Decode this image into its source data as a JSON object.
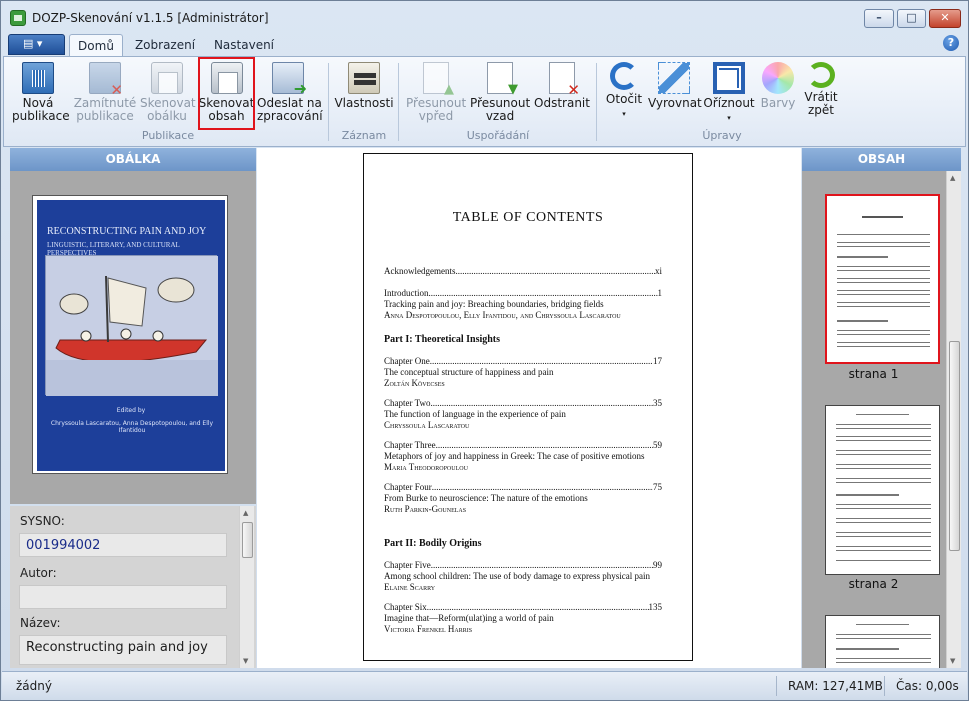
{
  "window": {
    "title": "DOZP-Skenování v1.1.5 [Administrátor]",
    "min_symbol": "–",
    "max_symbol": "□",
    "close_symbol": "✕"
  },
  "ribbon_tabs": [
    {
      "label": "Domů",
      "active": true
    },
    {
      "label": "Zobrazení",
      "active": false
    },
    {
      "label": "Nastavení",
      "active": false
    }
  ],
  "help_symbol": "?",
  "app_menu_symbol": "▤ ▾",
  "ribbon": {
    "publikace": {
      "group_label": "Publikace",
      "nova": {
        "label": "Nová\npublikace",
        "icon": "book-icon",
        "enabled": true
      },
      "zamitnute": {
        "label": "Zamítnuté\npublikace",
        "icon": "rejected-book-icon",
        "enabled": false
      },
      "skenovat_obalku": {
        "label": "Skenovat\nobálku",
        "icon": "scanner-icon",
        "enabled": false
      },
      "skenovat_obsah": {
        "label": "Skenovat\nobsah",
        "icon": "scanner-icon",
        "enabled": true,
        "highlighted": true
      },
      "odeslat": {
        "label": "Odeslat na\nzpracování",
        "icon": "send-icon",
        "enabled": true
      }
    },
    "zaznam": {
      "group_label": "Záznam",
      "vlastnosti": {
        "label": "Vlastnosti",
        "icon": "hand-card-icon",
        "enabled": true
      }
    },
    "usporadani": {
      "group_label": "Uspořádání",
      "presunout_vpred": {
        "label": "Přesunout\nvpřed",
        "icon": "page-up-icon",
        "enabled": false
      },
      "presunout_vzad": {
        "label": "Přesunout\nvzad",
        "icon": "page-down-icon",
        "enabled": true
      },
      "odstranit": {
        "label": "Odstranit",
        "icon": "page-delete-icon",
        "enabled": true
      }
    },
    "upravy": {
      "group_label": "Úpravy",
      "otocit": {
        "label": "Otočit",
        "icon": "rotate-icon",
        "enabled": true,
        "dropdown": "▾"
      },
      "vyrovnat": {
        "label": "Vyrovnat",
        "icon": "straighten-icon",
        "enabled": true
      },
      "oriznout": {
        "label": "Oříznout",
        "icon": "crop-icon",
        "enabled": true,
        "dropdown": "▾"
      },
      "barvy": {
        "label": "Barvy",
        "icon": "color-wheel-icon",
        "enabled": false
      },
      "vratit": {
        "label": "Vrátit\nzpět",
        "icon": "undo-icon",
        "enabled": true
      }
    }
  },
  "left_panel": {
    "header": "OBÁLKA",
    "cover": {
      "title": "RECONSTRUCTING PAIN AND JOY",
      "subtitle": "LINGUISTIC, LITERARY, AND CULTURAL PERSPECTIVES",
      "edited_by": "Edited by",
      "editors": "Chryssoula Lascaratou, Anna Despotopoulou, and Elly Ifantidou"
    },
    "fields": {
      "sysno_label": "SYSNO:",
      "sysno_value": "001994002",
      "autor_label": "Autor:",
      "autor_value": "",
      "nazev_label": "Název:",
      "nazev_value": "Reconstructing pain and joy"
    }
  },
  "page_preview": {
    "title": "TABLE OF CONTENTS",
    "entries": [
      {
        "name": "Acknowledgements",
        "page": "xi",
        "title": "",
        "author": ""
      },
      {
        "name": "Introduction",
        "page": "1",
        "title": "Tracking pain and joy: Breaching boundaries, bridging fields",
        "author": "Anna Despotopoulou, Elly Ifantidou, and Chryssoula Lascaratou"
      },
      {
        "name": "Chapter One",
        "page": "17",
        "title": "The conceptual structure of happiness and pain",
        "author": "Zoltán Kövecses"
      },
      {
        "name": "Chapter Two",
        "page": "35",
        "title": "The function of language in the experience of pain",
        "author": "Chryssoula Lascaratou"
      },
      {
        "name": "Chapter Three",
        "page": "59",
        "title": "Metaphors of joy and happiness in Greek: The case of positive emotions",
        "author": "Maria Theodoropoulou"
      },
      {
        "name": "Chapter Four",
        "page": "75",
        "title": "From Burke to neuroscience: The nature of the emotions",
        "author": "Ruth Parkin-Gounelas"
      },
      {
        "name": "Chapter Five",
        "page": "99",
        "title": "Among school children: The use of body damage to express physical pain",
        "author": "Elaine Scarry"
      },
      {
        "name": "Chapter Six",
        "page": "135",
        "title": "Imagine that—Reform(ulat)ing a world of pain",
        "author": "Victoria Frenkel Harris"
      }
    ],
    "parts": [
      "Part I: Theoretical Insights",
      "Part II: Bodily Origins"
    ]
  },
  "right_panel": {
    "header": "OBSAH",
    "thumbs": [
      {
        "caption": "strana 1",
        "selected": true
      },
      {
        "caption": "strana 2",
        "selected": false
      },
      {
        "caption": "",
        "selected": false
      }
    ]
  },
  "status": {
    "left": "žádný",
    "ram": "RAM: 127,41MB",
    "time": "Čas: 0,00s"
  },
  "colors": {
    "highlight": "#e0141c",
    "panel_header": "#7ea3d2",
    "ribbon_bg": "#eef3fa"
  }
}
